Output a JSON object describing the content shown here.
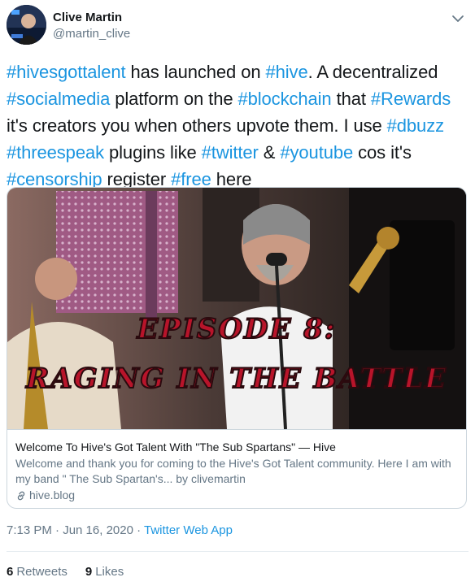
{
  "author": {
    "name": "Clive Martin",
    "handle": "@martin_clive"
  },
  "tweet": {
    "segments": [
      {
        "text": "#hivesgottalent",
        "hashtag": true
      },
      {
        "text": " has launched on ",
        "hashtag": false
      },
      {
        "text": "#hive",
        "hashtag": true
      },
      {
        "text": ". A decentralized ",
        "hashtag": false
      },
      {
        "text": "#socialmedia",
        "hashtag": true
      },
      {
        "text": " platform on the ",
        "hashtag": false
      },
      {
        "text": "#blockchain",
        "hashtag": true
      },
      {
        "text": " that ",
        "hashtag": false
      },
      {
        "text": "#Rewards",
        "hashtag": true
      },
      {
        "text": " it's creators you when others upvote them. I use ",
        "hashtag": false
      },
      {
        "text": "#dbuzz",
        "hashtag": true
      },
      {
        "text": " ",
        "hashtag": false
      },
      {
        "text": "#threespeak",
        "hashtag": true
      },
      {
        "text": " plugins like ",
        "hashtag": false
      },
      {
        "text": "#twitter",
        "hashtag": true
      },
      {
        "text": " & ",
        "hashtag": false
      },
      {
        "text": "#youtube",
        "hashtag": true
      },
      {
        "text": " cos it's ",
        "hashtag": false
      },
      {
        "text": "#censorship",
        "hashtag": true
      },
      {
        "text": " register ",
        "hashtag": false
      },
      {
        "text": "#free",
        "hashtag": true
      },
      {
        "text": " here",
        "hashtag": false
      }
    ]
  },
  "card": {
    "image_caption_line1": "EPISODE 8:",
    "image_caption_line2": "RAGING IN THE BATTLE",
    "title": "Welcome To Hive's Got Talent With \"The Sub Spartans\" — Hive",
    "description": "Welcome and thank you for coming to the Hive's Got Talent community. Here I am with my band  \" The Sub Spartan's... by clivemartin",
    "domain": "hive.blog"
  },
  "meta": {
    "time": "7:13 PM · Jun 16, 2020 · ",
    "source": "Twitter Web App"
  },
  "stats": {
    "retweets_count": "6",
    "retweets_label": "Retweets",
    "likes_count": "9",
    "likes_label": "Likes"
  },
  "colors": {
    "link": "#1b95e0",
    "caption_fill": "#b8142a"
  },
  "icons": {
    "menu": "chevron-down-icon",
    "domain": "link-icon"
  }
}
